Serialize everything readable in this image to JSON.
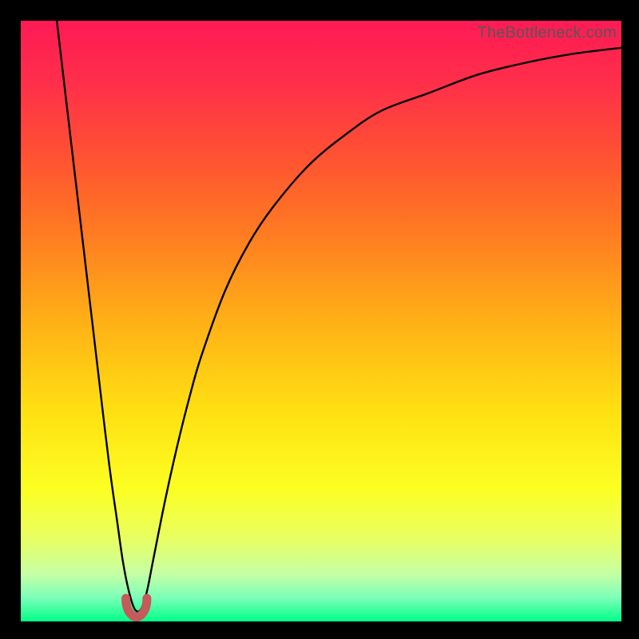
{
  "attribution": "TheBottleneck.com",
  "colors": {
    "frame": "#000000",
    "gradient_stops": [
      {
        "offset": 0.0,
        "color": "#ff1a55"
      },
      {
        "offset": 0.1,
        "color": "#ff2e4a"
      },
      {
        "offset": 0.22,
        "color": "#ff5033"
      },
      {
        "offset": 0.35,
        "color": "#ff7a22"
      },
      {
        "offset": 0.5,
        "color": "#ffb016"
      },
      {
        "offset": 0.65,
        "color": "#ffe012"
      },
      {
        "offset": 0.78,
        "color": "#fcff22"
      },
      {
        "offset": 0.86,
        "color": "#e9ff60"
      },
      {
        "offset": 0.92,
        "color": "#c6ffa3"
      },
      {
        "offset": 0.96,
        "color": "#7dffb9"
      },
      {
        "offset": 1.0,
        "color": "#00ff88"
      }
    ],
    "curve": "#000000",
    "marker": "#c45a5a"
  },
  "chart_data": {
    "type": "line",
    "title": "",
    "xlabel": "",
    "ylabel": "",
    "xlim": [
      0,
      100
    ],
    "ylim": [
      0,
      100
    ],
    "series": [
      {
        "name": "bottleneck-curve",
        "x": [
          6,
          8,
          10,
          12,
          14,
          15,
          16,
          17,
          18,
          19,
          20,
          21,
          22,
          24,
          26,
          28,
          30,
          34,
          38,
          42,
          48,
          54,
          60,
          68,
          76,
          84,
          92,
          100
        ],
        "y": [
          100,
          83,
          66,
          49,
          32,
          24,
          17,
          10,
          5,
          2,
          2,
          5,
          10,
          20,
          29,
          37,
          44,
          55,
          63,
          69,
          76,
          81,
          85,
          88,
          91,
          93,
          94.5,
          95.5
        ]
      }
    ],
    "annotations": [
      {
        "name": "optimal-marker",
        "x_range": [
          17.5,
          21
        ],
        "y": 2,
        "shape": "u"
      }
    ]
  }
}
